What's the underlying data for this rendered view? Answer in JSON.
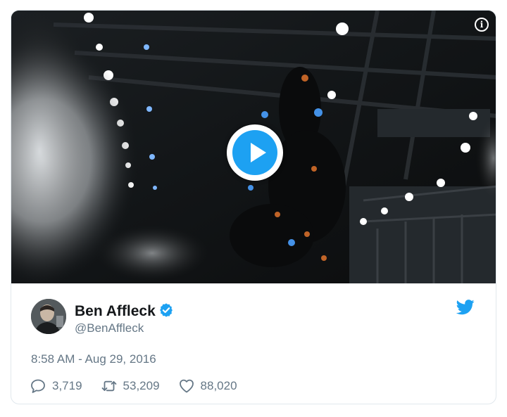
{
  "tweet": {
    "author": {
      "name": "Ben Affleck",
      "handle": "@BenAffleck",
      "verified": true
    },
    "timestamp": "8:58 AM - Aug 29, 2016",
    "stats": {
      "replies": "3,719",
      "retweets": "53,209",
      "likes": "88,020"
    }
  },
  "media": {
    "type": "video",
    "info_icon": "info-icon",
    "play_icon": "play-icon"
  },
  "icons": {
    "reply": "reply-icon",
    "retweet": "retweet-icon",
    "like": "heart-icon",
    "brand": "twitter-bird-icon",
    "verified": "verified-badge-icon"
  },
  "colors": {
    "brand_blue": "#1da1f2",
    "text_primary": "#14171a",
    "text_secondary": "#657786",
    "border": "#e1e8ed"
  }
}
